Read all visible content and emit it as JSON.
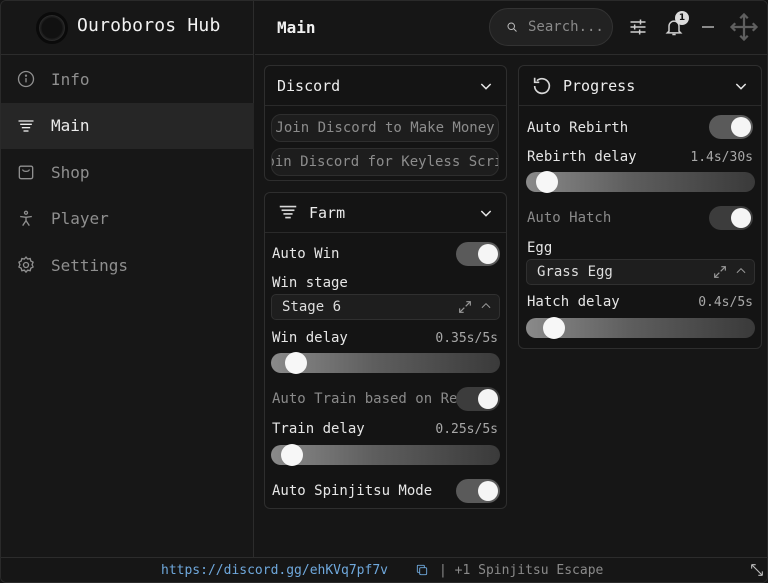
{
  "app": {
    "title": "Ouroboros Hub"
  },
  "sidebar": {
    "items": [
      {
        "label": "Info",
        "icon": "info-icon"
      },
      {
        "label": "Main",
        "icon": "menu-lines-icon",
        "active": true
      },
      {
        "label": "Shop",
        "icon": "shopping-bag-icon"
      },
      {
        "label": "Player",
        "icon": "person-icon"
      },
      {
        "label": "Settings",
        "icon": "gear-icon"
      }
    ]
  },
  "header": {
    "title": "Main",
    "search_placeholder": "Search...",
    "notification_count": "1"
  },
  "discord": {
    "title": "Discord",
    "buttons": [
      "Join Discord to Make Money",
      "Join Discord for Keyless Script"
    ]
  },
  "farm": {
    "title": "Farm",
    "auto_win_label": "Auto Win",
    "auto_win_on": true,
    "win_stage_label": "Win stage",
    "win_stage_value": "Stage 6",
    "win_delay_label": "Win delay",
    "win_delay_value": "0.35s/5s",
    "win_delay_fraction": 0.07,
    "auto_train_label": "Auto Train based on Rebirth",
    "auto_train_on": false,
    "train_delay_label": "Train delay",
    "train_delay_value": "0.25s/5s",
    "train_delay_fraction": 0.05,
    "auto_spinjitsu_label": "Auto Spinjitsu Mode",
    "auto_spinjitsu_on": true
  },
  "progress": {
    "title": "Progress",
    "auto_rebirth_label": "Auto Rebirth",
    "auto_rebirth_on": true,
    "rebirth_delay_label": "Rebirth delay",
    "rebirth_delay_value": "1.4s/30s",
    "rebirth_delay_fraction": 0.047,
    "auto_hatch_label": "Auto Hatch",
    "auto_hatch_on": false,
    "egg_label": "Egg",
    "egg_value": "Grass Egg",
    "hatch_delay_label": "Hatch delay",
    "hatch_delay_value": "0.4s/5s",
    "hatch_delay_fraction": 0.08
  },
  "footer": {
    "link": "https://discord.gg/ehKVq7pf7v",
    "status": "| +1 Spinjitsu Escape"
  },
  "colors": {
    "accent_link": "#6fa8dc",
    "background": "#161616"
  }
}
